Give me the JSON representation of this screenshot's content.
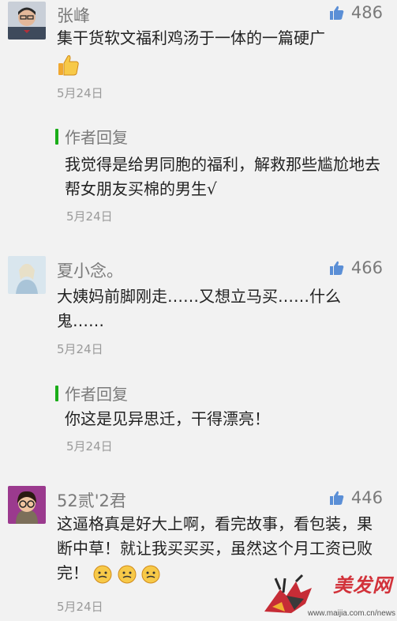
{
  "comments": [
    {
      "name": "张峰",
      "likes": "486",
      "text": "集干货软文福利鸡汤于一体的一篇硬广",
      "date": "5月24日",
      "reply": {
        "label": "作者回复",
        "text": "我觉得是给男同胞的福利，解救那些尴尬地去帮女朋友买棉的男生√",
        "date": "5月24日"
      }
    },
    {
      "name": "夏小念。",
      "likes": "466",
      "text": "大姨妈前脚刚走……又想立马买……什么鬼……",
      "date": "5月24日",
      "reply": {
        "label": "作者回复",
        "text": "你这是见异思迁，干得漂亮！",
        "date": "5月24日"
      }
    },
    {
      "name": "52贰'2君",
      "likes": "446",
      "text": "这逼格真是好大上啊，看完故事，看包装，果断中草！就让我买买买，虽然这个月工资已败完！",
      "date": "5月24日"
    }
  ],
  "watermark": {
    "brand": "美发网",
    "url": "www.maijia.com.cn/news"
  },
  "colors": {
    "background": "#f2f2f2",
    "reply_accent": "#1aad19",
    "like_icon": "#5b8fd6",
    "watermark_red": "#d2323a"
  }
}
